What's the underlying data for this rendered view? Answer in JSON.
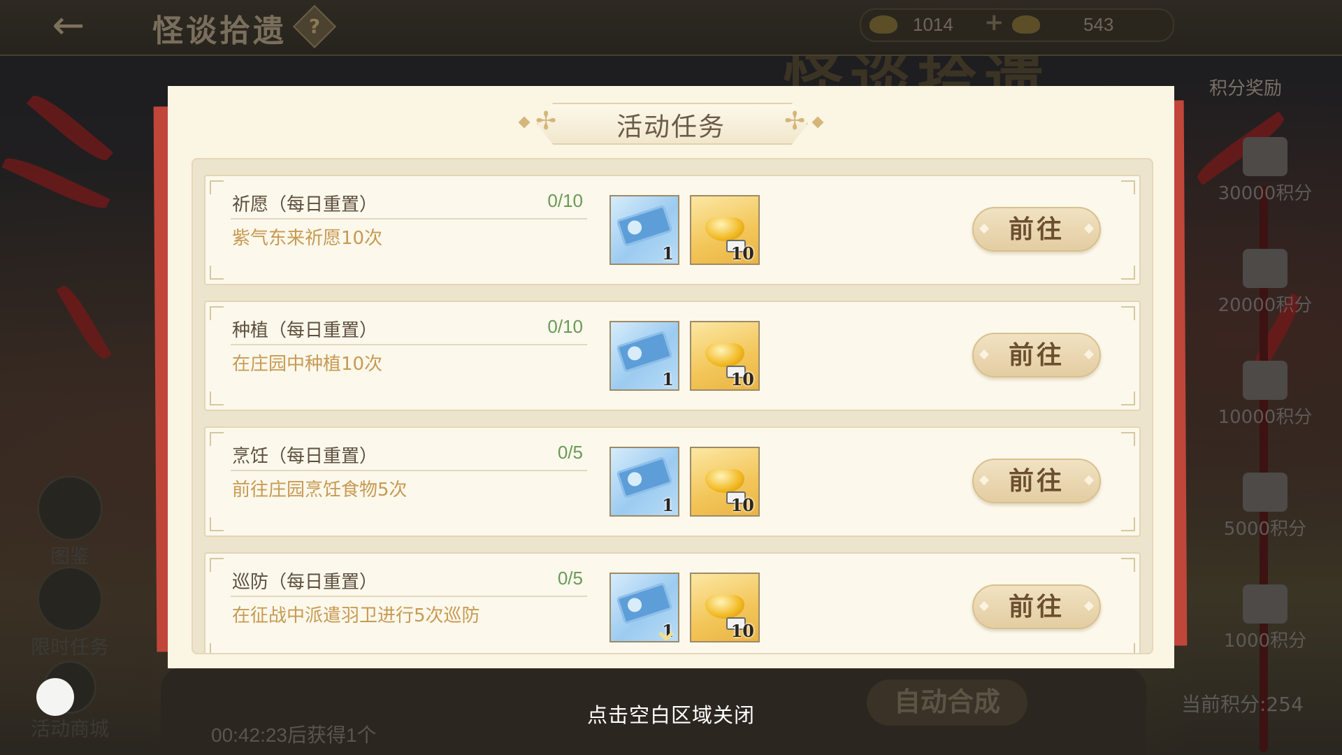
{
  "header": {
    "title": "怪谈拾遗",
    "help": "?",
    "back": "←",
    "banner": "怪谈拾遗",
    "currency_a": "1014",
    "currency_b": "543"
  },
  "rewards": {
    "title": "积分奖励",
    "items": [
      {
        "label": "30000积分"
      },
      {
        "label": "20000积分"
      },
      {
        "label": "10000积分"
      },
      {
        "label": "5000积分"
      },
      {
        "label": "1000积分"
      }
    ],
    "current": "当前积分:254"
  },
  "side_buttons": [
    {
      "label": "图鉴",
      "icon": "book-icon"
    },
    {
      "label": "限时任务",
      "icon": "cart-icon"
    },
    {
      "label": "活动商城",
      "icon": "shop-icon"
    }
  ],
  "bottom": {
    "timer": "00:42:23后获得1个",
    "auto_merge": "自动合成",
    "close_hint": "点击空白区域关闭"
  },
  "modal": {
    "title": "活动任务",
    "tasks": [
      {
        "name": "祈愿（每日重置）",
        "progress": "0/10",
        "desc": "紫气东来祈愿10次",
        "reward_ticket": "1",
        "reward_gold": "10",
        "button": "前往"
      },
      {
        "name": "种植（每日重置）",
        "progress": "0/10",
        "desc": "在庄园中种植10次",
        "reward_ticket": "1",
        "reward_gold": "10",
        "button": "前往"
      },
      {
        "name": "烹饪（每日重置）",
        "progress": "0/5",
        "desc": "前往庄园烹饪食物5次",
        "reward_ticket": "1",
        "reward_gold": "10",
        "button": "前往"
      },
      {
        "name": "巡防（每日重置）",
        "progress": "0/5",
        "desc": "在征战中派遣羽卫进行5次巡防",
        "reward_ticket": "1",
        "reward_gold": "10",
        "button": "前往"
      }
    ]
  },
  "colors": {
    "modal_bg": "#fbf5e3",
    "progress": "#6a9a57",
    "desc": "#c79a52",
    "accent_red": "#c0463a"
  }
}
